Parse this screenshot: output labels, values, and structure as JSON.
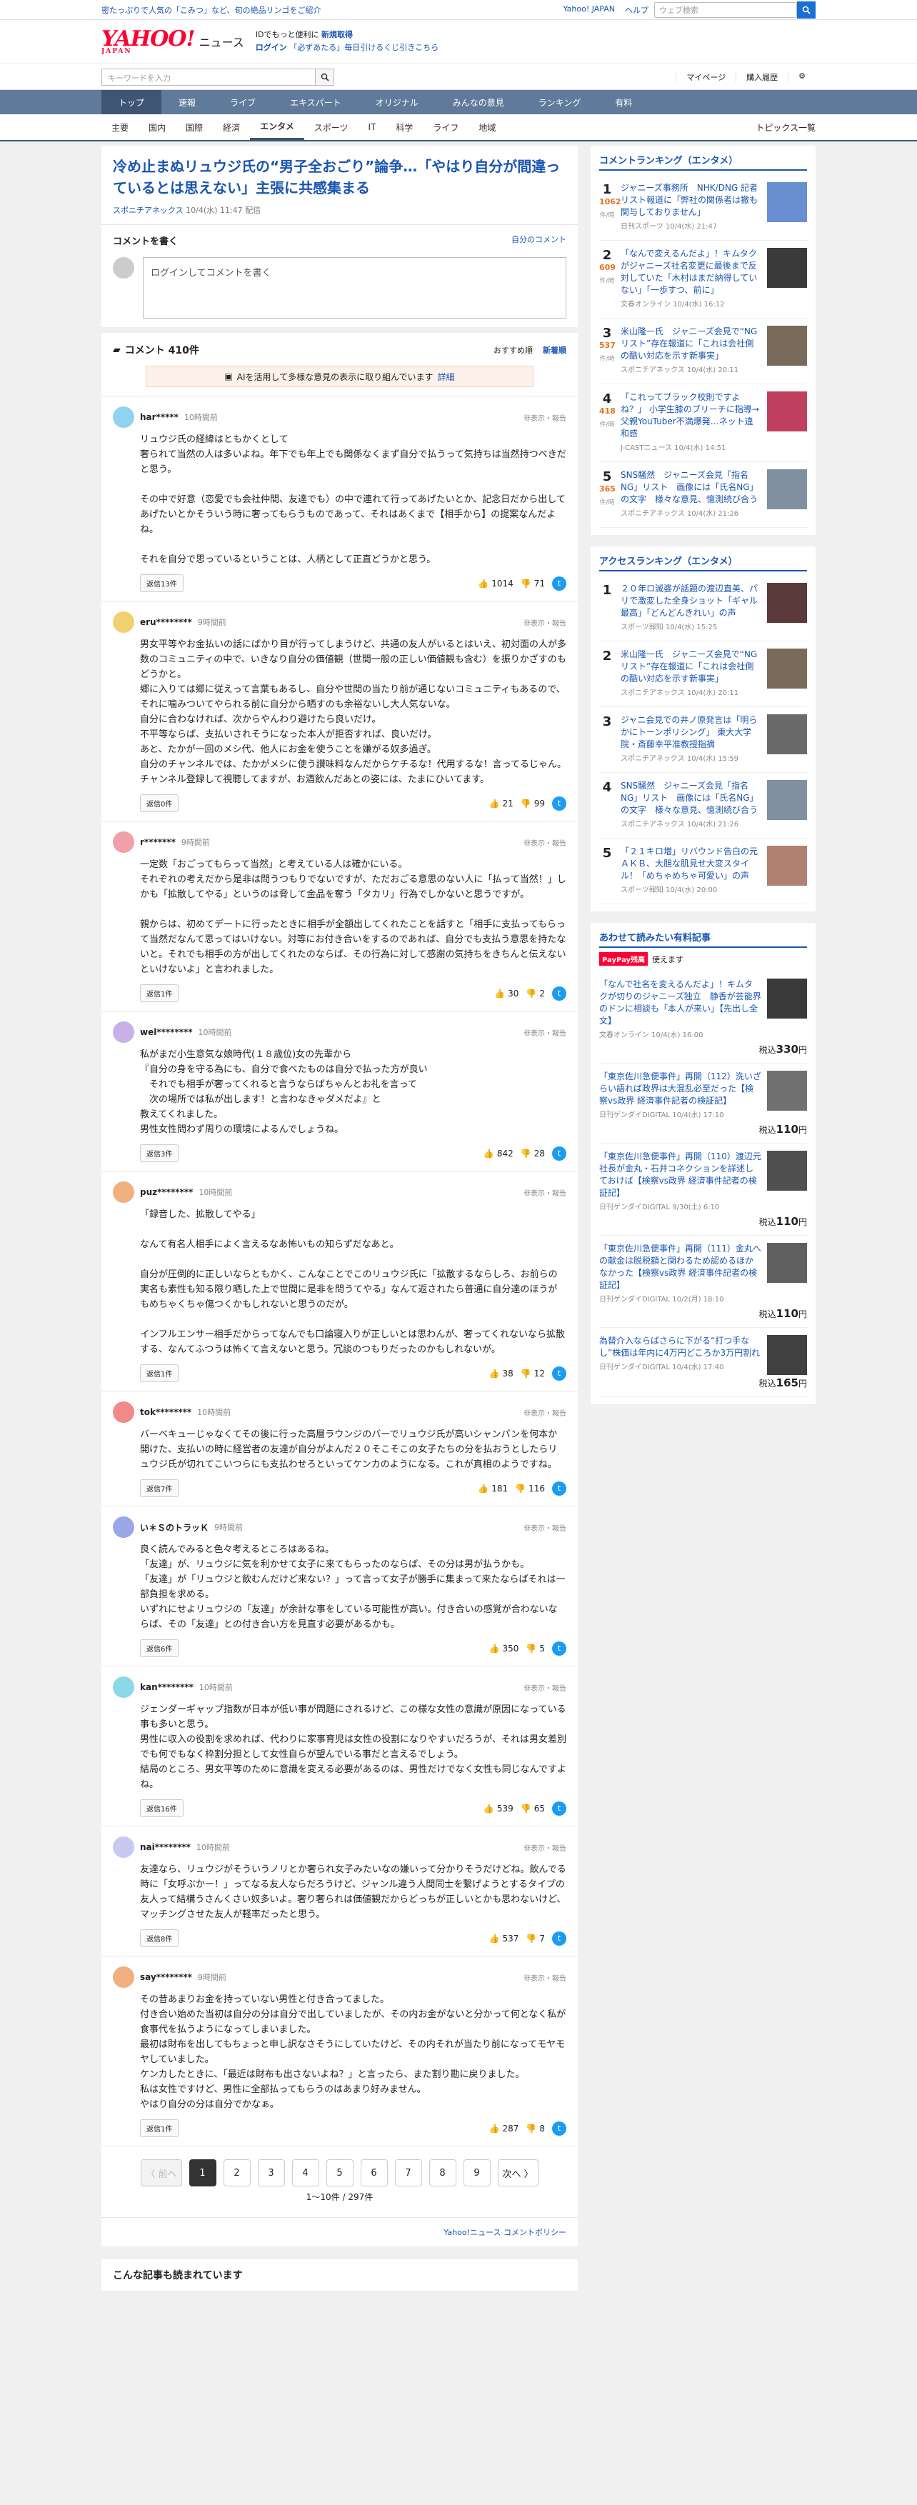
{
  "topbar": {
    "promo": "密たっぷりで人気の「こみつ」など、旬の絶品リンゴをご紹介",
    "links": [
      "Yahoo! JAPAN",
      "ヘルプ"
    ],
    "search_placeholder": "ウェブ検索"
  },
  "header": {
    "logo": "YAHOO!",
    "logo_sub": "JAPAN",
    "service": "ニュース",
    "promo_line1": "IDでもっと便利に",
    "promo_link1": "新規取得",
    "promo_line2_a": "ログイン",
    "promo_line2_b": "「必ずあたる」毎日引けるくじ引きこちら"
  },
  "searchrow": {
    "placeholder": "キーワードを入力",
    "links": [
      "マイページ",
      "購入履歴"
    ]
  },
  "nav1": [
    "トップ",
    "速報",
    "ライブ",
    "エキスパート",
    "オリジナル",
    "みんなの意見",
    "ランキング",
    "有料"
  ],
  "nav2": [
    "主要",
    "国内",
    "国際",
    "経済",
    "エンタメ",
    "スポーツ",
    "IT",
    "科学",
    "ライフ",
    "地域"
  ],
  "nav2_right": "トピックス一覧",
  "article": {
    "title": "冷め止まぬリュウジ氏の“男子全おごり”論争…「やはり自分が間違っているとは思えない」主張に共感集まる",
    "source": "スポニチアネックス",
    "date": "10/4(水) 11:47 配信"
  },
  "writebox": {
    "title": "コメントを書く",
    "my": "自分のコメント",
    "placeholder": "ログインしてコメントを書く"
  },
  "comments_head": {
    "title": "コメント 410件",
    "sort1": "おすすめ順",
    "sort2": "新着順"
  },
  "ai_notice": {
    "text": "AIを活用して多様な意見の表示に取り組んでいます",
    "link": "詳細"
  },
  "comments": [
    {
      "user": "har*****",
      "time": "10時間前",
      "color": "#8fd3f0",
      "body": "リュウジ氏の経緯はともかくとして\n奢られて当然の人は多いよね。年下でも年上でも関係なくまず自分で払うって気持ちは当然持つべきだと思う。\n\nその中で好意（恋愛でも会社仲間、友達でも）の中で連れて行ってあげたいとか、記念日だから出してあげたいとかそういう時に奢ってもらうものであって、それはあくまで【相手から】の提案なんだよね。\n\nそれを自分で思っているということは、人柄として正直どうかと思う。",
      "reply": "返信13件",
      "up": "1014",
      "down": "71"
    },
    {
      "user": "eru********",
      "time": "9時間前",
      "color": "#f0d070",
      "body": "男女平等やお金払いの話にばかり目が行ってしまうけど、共通の友人がいるとはいえ、初対面の人が多数のコミュニティの中で、いきなり自分の価値観（世間一般の正しい価値観も含む）を振りかざすのもどうかと。\n郷に入りては郷に従えって言葉もあるし、自分や世間の当たり前が通じないコミュニティもあるので、それに噛みついてやられる前に自分から晒すのも余裕ないし大人気ないな。\n自分に合わなければ、次からやんわり避けたら良いだけ。\n不平等ならば、支払いされそうになった本人が拒否すれば、良いだけ。\nあと、たかが一回のメシ代、他人にお金を使うことを嫌がる奴多過ぎ。\n自分のチャンネルでは、たかがメシに使う讃味料なんだからケチるな！代用するな！言ってるじゃん。\nチャンネル登録して視聴してますが、お酒飲んだあとの姿には、たまにひいてます。",
      "reply": "返信0件",
      "up": "21",
      "down": "99"
    },
    {
      "user": "r*******",
      "time": "9時間前",
      "color": "#f0a0a8",
      "body": "一定数「おごってもらって当然」と考えている人は確かにいる。\nそれぞれの考えだから是非は問うつもりでないですが、ただおごる意思のない人に「払って当然！」しかも「拡散してやる」というのは脅して金品を奪う「タカリ」行為でしかないと思うですが。\n\n親からは、初めてデートに行ったときに相手が全額出してくれたことを話すと「相手に支払ってもらって当然だなんて思ってはいけない。対等にお付き合いをするのであれば、自分でも支払う意思を持たないと。それでも相手の方が出してくれたのならば、その行為に対して感謝の気持ちをきちんと伝えないといけないよ」と言われました。",
      "reply": "返信1件",
      "up": "30",
      "down": "2"
    },
    {
      "user": "wel********",
      "time": "10時間前",
      "color": "#c8b0e8",
      "body": "私がまだ小生意気な娘時代(１８歳位)女の先輩から\n『自分の身を守る為にも、自分で食べたものは自分で払った方が良い\n　それでも相手が奢ってくれると言うならばちゃんとお礼を言って\n　次の場所では私が出します！と言わなきゃダメだよ』と\n教えてくれました。\n男性女性問わず周りの環境によるんでしょうね。",
      "reply": "返信3件",
      "up": "842",
      "down": "28"
    },
    {
      "user": "puz********",
      "time": "10時間前",
      "color": "#f0b080",
      "body": "「録音した、拡散してやる」\n\nなんて有名人相手によく言えるなあ怖いもの知らずだなあと。\n\n自分が圧倒的に正しいならともかく、こんなことでこのリュウジ氏に「拡散するならしろ、お前らの実名も素性も知る限り晒した上で世間に是非を問うてやる」なんて返されたら普通に自分達のほうがもめちゃくちゃ傷つくかもしれないと思うのだが。\n\nインフルエンサー相手だからってなんでも口論寝入りが正しいとは思わんが、奢ってくれないなら拡散する、なんてふつうは怖くて言えないと思う。冗談のつもりだったのかもしれないが。",
      "reply": "返信1件",
      "up": "38",
      "down": "12"
    },
    {
      "user": "tok********",
      "time": "10時間前",
      "color": "#f08a8a",
      "body": "バーベキューじゃなくてその後に行った高層ラウンジのバーでリュウジ氏が高いシャンパンを何本か開けた、支払いの時に経営者の友達が自分がよんだ２０そこそこの女子たちの分を払おうとしたらリュウジ氏が切れてこいつらにも支払わせろといってケンカのようになる。これが真相のようですね。",
      "reply": "返信7件",
      "up": "181",
      "down": "116"
    },
    {
      "user": "い＊ＳのトラッＫ",
      "time": "9時間前",
      "color": "#9aa6e8",
      "body": "良く読んでみると色々考えるところはあるね。\n「友達」が、リュウジに気を利かせて女子に来てもらったのならば、その分は男が払うかも。\n「友達」が「リュウジと飲むんだけど来ない？」って言って女子が勝手に集まって来たならばそれは一部負担を求める。\nいずれにせよリュウジの「友達」が余計な事をしている可能性が高い。付き合いの感覚が合わないならば、その「友達」との付き合い方を見直す必要があるかも。",
      "reply": "返信6件",
      "up": "350",
      "down": "5"
    },
    {
      "user": "kan********",
      "time": "10時間前",
      "color": "#8ad8e8",
      "body": "ジェンダーギャップ指数が日本が低い事が問題にされるけど、この様な女性の意識が原因になっている事も多いと思う。\n男性に収入の役割を求めれば、代わりに家事育児は女性の役割になりやすいだろうが、それは男女差別でも何でもなく枠割分担として女性自らが望んでいる事だと言えるでしょう。\n結局のところ、男女平等のために意識を変える必要があるのは、男性だけでなく女性も同じなんですよね。",
      "reply": "返信16件",
      "up": "539",
      "down": "65"
    },
    {
      "user": "nai********",
      "time": "10時間前",
      "color": "#c8c8f0",
      "body": "友達なら、リュウジがそういうノリとか奢られ女子みたいなの嫌いって分かりそうだけどね。飲んでる時に「女呼ぶかー！」ってなる友人ならだろうけど、ジャンル違う人間同士を繋げようとするタイプの友人って結構うさんくさい奴多いよ。奢り奢られは価値観だからどっちが正しいとかも思わないけど、マッチングさせた友人が軽率だったと思う。",
      "reply": "返信8件",
      "up": "537",
      "down": "7"
    },
    {
      "user": "say********",
      "time": "9時間前",
      "color": "#f0b080",
      "body": "その昔あまりお金を持っていない男性と付き合ってました。\n付き合い始めた当初は自分の分は自分で出していましたが、その内お金がないと分かって何となく私が食事代を払うようになってしまいました。\n最初は財布を出してもちょっと申し訳なさそうにしていたけど、その内それが当たり前になってモヤモヤしていました。\nケンカしたときに、「最近は財布も出さないよね？」と言ったら、また割り勘に戻りました。\n私は女性ですけど、男性に全部払ってもらうのはあまり好みません。\nやはり自分の分は自分でかなぁ。",
      "reply": "返信1件",
      "up": "287",
      "down": "8"
    }
  ],
  "report_label": "非表示・報告",
  "pager": {
    "prev": "〈 前へ",
    "pages": [
      "1",
      "2",
      "3",
      "4",
      "5",
      "6",
      "7",
      "8",
      "9"
    ],
    "next": "次へ 〉",
    "count": "1〜10件 / 297件"
  },
  "policy": "Yahoo!ニュース コメントポリシー",
  "more": "こんな記事も読まれています",
  "comment_ranking": {
    "title": "コメントランキング（エンタメ）",
    "unit": "件/時",
    "items": [
      {
        "no": "1",
        "count": "1062",
        "title": "ジャニーズ事務所　NHK/DNG 記者リスト報道に「弊社の関係者は撤も関与しておりません」",
        "src": "日刊スポーツ 10/4(水) 21:47",
        "color": "#6a8fd0"
      },
      {
        "no": "2",
        "count": "609",
        "title": "「なんで変えるんだよ」！キムタクがジャニーズ社名変更に最後まで反対していた「木村はまだ納得していない」「一歩すつ、前に」",
        "src": "文春オンライン 10/4(水) 16:12",
        "color": "#3a3a3a"
      },
      {
        "no": "3",
        "count": "537",
        "title": "米山隆一氏　ジャニーズ会見で“NGリスト”存在報道に「これは会社側の酷い対応を示す新事実」",
        "src": "スポニチアネックス 10/4(水) 20:11",
        "color": "#7a6a5a"
      },
      {
        "no": "4",
        "count": "418",
        "title": "「これってブラック校則ですよね？」 小学生膝のブリーチに指導→父親YouTuber不満爆発…ネット違和感",
        "src": "J-CASTニュース 10/4(水) 14:51",
        "color": "#c04060"
      },
      {
        "no": "5",
        "count": "365",
        "title": "SNS騒然　ジャニーズ会見「指名NG」リスト　画像には「氏名NG」の文字　様々な意見、憶測続び合う",
        "src": "スポニチアネックス 10/4(水) 21:26",
        "color": "#8090a0"
      }
    ]
  },
  "access_ranking": {
    "title": "アクセスランキング（エンタメ）",
    "items": [
      {
        "no": "1",
        "title": "２０年ロ滅婆が話題の渡辺直美、パリで激変した全身ショット「ギャル最高」「どんどんきれい」の声",
        "src": "スポーツ報知 10/4(水) 15:25",
        "color": "#5a3a3a"
      },
      {
        "no": "2",
        "title": "米山隆一氏　ジャニーズ会見で“NGリスト”存在報道に「これは会社側の酷い対応を示す新事実」",
        "src": "スポニチアネックス 10/4(水) 20:11",
        "color": "#7a6a5a"
      },
      {
        "no": "3",
        "title": "ジャニ会見での井ノ原発言は「明らかにトーンポリシング」 東大大学院・斎藤幸平准教授指摘",
        "src": "スポニチアネックス 10/4(水) 15:59",
        "color": "#6a6a6a"
      },
      {
        "no": "4",
        "title": "SNS騒然　ジャニーズ会見「指名NG」リスト　画像には「氏名NG」の文字　様々な意見、憶測続び合う",
        "src": "スポニチアネックス 10/4(水) 21:26",
        "color": "#8090a0"
      },
      {
        "no": "5",
        "title": "「２１キロ増」リバウンド告白の元ＡＫＢ、大胆な肌見せ大変スタイル！「めちゃめちゃ可愛い」の声",
        "src": "スポーツ報知 10/4(水) 20:00",
        "color": "#b08070"
      }
    ]
  },
  "paid": {
    "title": "あわせて読みたい有料記事",
    "pp_label": "PayPay残高",
    "pp_text": "使えます",
    "items": [
      {
        "title": "「なんで社名を変えるんだよ」！キムタクが切りのジャニーズ独立　静香が芸能界のドンに相談も「本人が来い」【先出し全文】",
        "src": "文春オンライン 10/4(水) 16:00",
        "price": "330",
        "color": "#3a3a3a"
      },
      {
        "title": "「東京佐川急便事件」再開（112）洗いざらい語れば政界は大混乱必至だった【検察vs政界 経済事件記者の検証記】",
        "src": "日刊ゲンダイDIGITAL 10/4(水) 17:10",
        "price": "110",
        "color": "#707070"
      },
      {
        "title": "「東京佐川急便事件」再開（110）渡辺元社長が金丸・石井コネクションを詳述しておけば【検察vs政界 経済事件記者の検証記】",
        "src": "日刊ゲンダイDIGITAL 9/30(土) 6:10",
        "price": "110",
        "color": "#505050"
      },
      {
        "title": "「東京佐川急便事件」再開（111）金丸への献金は脱税額と関わるため認めるほかなかった【検察vs政界 経済事件記者の検証記】",
        "src": "日刊ゲンダイDIGITAL 10/2(月) 18:10",
        "price": "110",
        "color": "#606060"
      },
      {
        "title": "為替介入ならばさらに下がる“打つ手なし”株価は年内に4万円どころか3万円割れ",
        "src": "日刊ゲンダイDIGITAL 10/4(水) 17:40",
        "price": "165",
        "color": "#404040"
      }
    ]
  },
  "price_prefix": "税込",
  "price_suffix": "円"
}
